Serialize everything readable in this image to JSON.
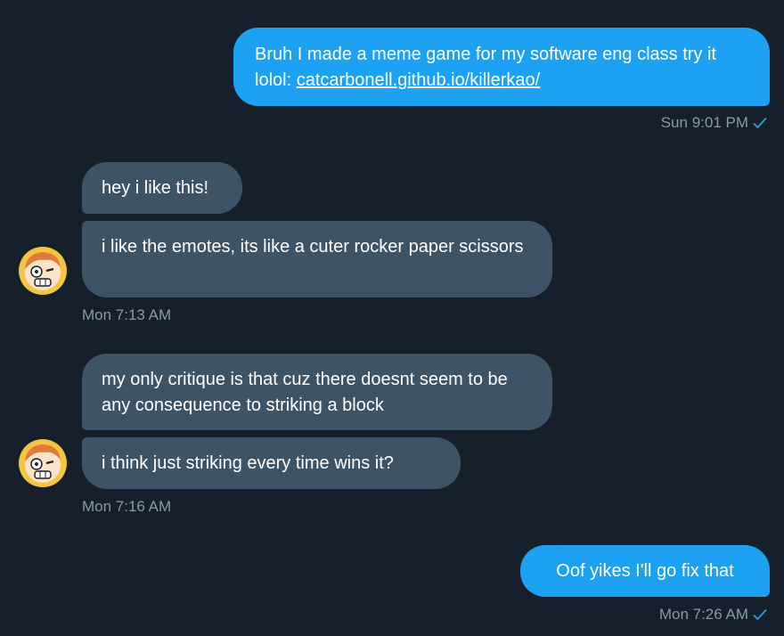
{
  "conversation": {
    "messages": [
      {
        "direction": "outgoing",
        "text_prefix": "Bruh I made a meme game for my software eng class try it lolol: ",
        "link": "catcarbonell.github.io/killerkao/",
        "time": "Sun 9:01 PM"
      },
      {
        "direction": "incoming",
        "bubbles": [
          "hey i like this!",
          "i like the emotes, its like a cuter rocker paper scissors"
        ],
        "time": "Mon 7:13 AM"
      },
      {
        "direction": "incoming",
        "bubbles": [
          "my only critique is that cuz there doesnt seem to be any consequence to striking a block",
          "i think just striking every time wins it?"
        ],
        "time": "Mon 7:16 AM"
      },
      {
        "direction": "outgoing",
        "text": "Oof yikes I'll go fix that",
        "time": "Mon 7:26 AM"
      }
    ]
  },
  "icons": {
    "read_receipt": "check-icon",
    "avatar": "avatar-cartoon-face"
  },
  "colors": {
    "background": "#16202a",
    "outgoing_bubble": "#1da1f2",
    "incoming_bubble": "#3d5466",
    "timestamp": "#8899a6",
    "avatar_ring": "#f5c542",
    "avatar_hair": "#e07a3f"
  }
}
